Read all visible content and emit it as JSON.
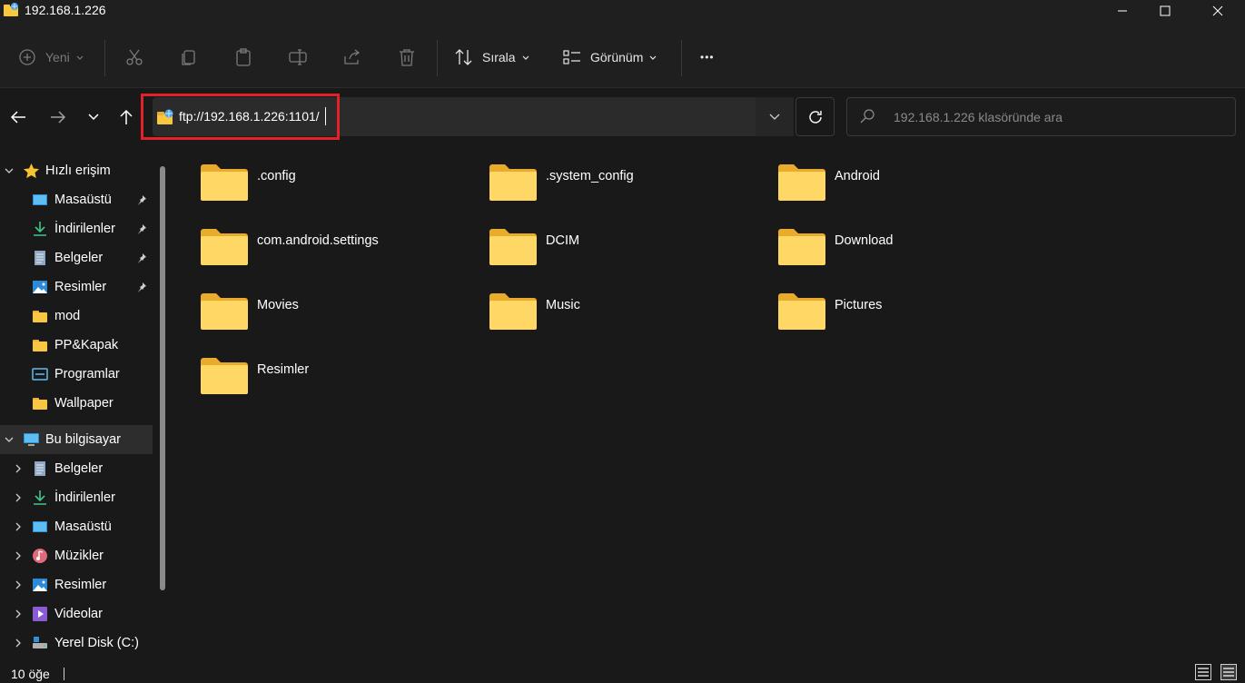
{
  "window": {
    "title": "192.168.1.226",
    "controls": {
      "minimize": "—",
      "maximize": "☐",
      "close": "✕"
    }
  },
  "toolbar": {
    "new_label": "Yeni",
    "sort_label": "Sırala",
    "view_label": "Görünüm",
    "more_label": "•••"
  },
  "address": {
    "path": "ftp://192.168.1.226:1101/",
    "highlight_color": "#e5202a"
  },
  "search": {
    "placeholder": "192.168.1.226 klasöründe ara"
  },
  "sidebar": {
    "quick_access": {
      "label": "Hızlı erişim",
      "items": [
        {
          "label": "Masaüstü",
          "icon": "desktop-icon",
          "pinned": true
        },
        {
          "label": "İndirilenler",
          "icon": "download-icon",
          "pinned": true
        },
        {
          "label": "Belgeler",
          "icon": "document-icon",
          "pinned": true
        },
        {
          "label": "Resimler",
          "icon": "pictures-icon",
          "pinned": true
        },
        {
          "label": "mod",
          "icon": "folder-icon",
          "pinned": false
        },
        {
          "label": "PP&Kapak",
          "icon": "folder-icon",
          "pinned": false
        },
        {
          "label": "Programlar",
          "icon": "programs-icon",
          "pinned": false
        },
        {
          "label": "Wallpaper",
          "icon": "folder-icon",
          "pinned": false
        }
      ]
    },
    "this_pc": {
      "label": "Bu bilgisayar",
      "items": [
        {
          "label": "Belgeler",
          "icon": "document-icon"
        },
        {
          "label": "İndirilenler",
          "icon": "download-icon"
        },
        {
          "label": "Masaüstü",
          "icon": "desktop-icon"
        },
        {
          "label": "Müzikler",
          "icon": "music-icon"
        },
        {
          "label": "Resimler",
          "icon": "pictures-icon"
        },
        {
          "label": "Videolar",
          "icon": "video-icon"
        },
        {
          "label": "Yerel Disk (C:)",
          "icon": "drive-icon"
        }
      ]
    }
  },
  "files": [
    {
      "name": ".config"
    },
    {
      "name": ".system_config"
    },
    {
      "name": "Android"
    },
    {
      "name": "com.android.settings"
    },
    {
      "name": "DCIM"
    },
    {
      "name": "Download"
    },
    {
      "name": "Movies"
    },
    {
      "name": "Music"
    },
    {
      "name": "Pictures"
    },
    {
      "name": "Resimler"
    }
  ],
  "status": {
    "item_count": "10 öğe"
  },
  "colors": {
    "background": "#191919",
    "folder_yellow": "#f8c640",
    "folder_front": "#ffd969"
  }
}
